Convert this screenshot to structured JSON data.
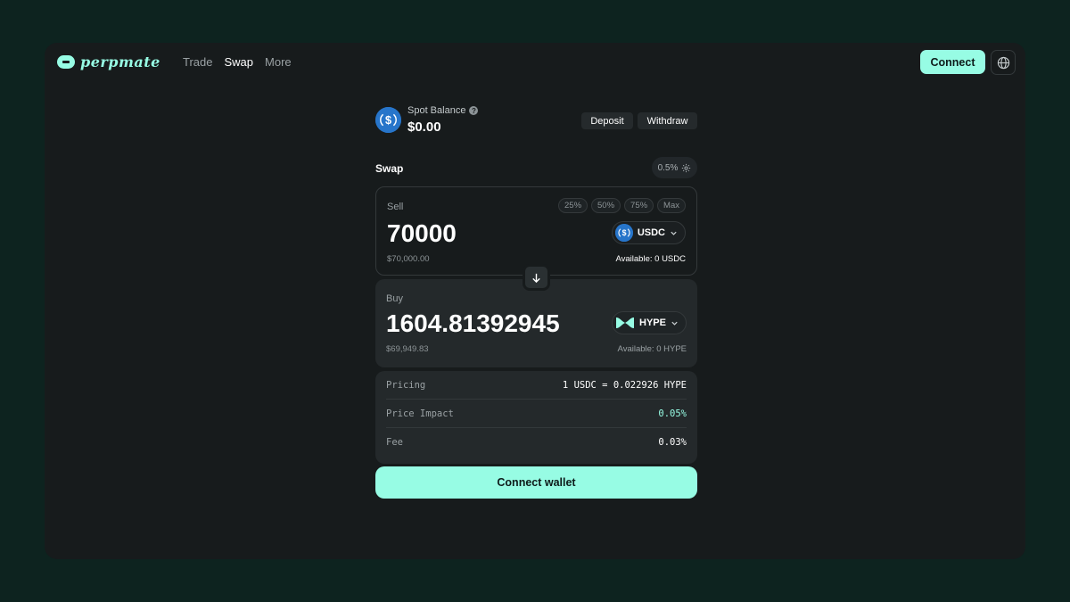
{
  "brand": {
    "name": "perpmate",
    "accent": "#97fce4"
  },
  "nav": {
    "links": [
      {
        "label": "Trade",
        "active": false
      },
      {
        "label": "Swap",
        "active": true
      },
      {
        "label": "More",
        "active": false
      }
    ],
    "connect_label": "Connect",
    "language_icon": "globe-icon"
  },
  "balance": {
    "label": "Spot Balance",
    "value": "$0.00",
    "deposit_label": "Deposit",
    "withdraw_label": "Withdraw"
  },
  "swap": {
    "title": "Swap",
    "slippage": "0.5%",
    "sell": {
      "label": "Sell",
      "percent_buttons": [
        "25%",
        "50%",
        "75%",
        "Max"
      ],
      "amount": "70000",
      "token": "USDC",
      "usd_value": "$70,000.00",
      "available": "Available: 0 USDC"
    },
    "buy": {
      "label": "Buy",
      "amount": "1604.81392945",
      "token": "HYPE",
      "usd_value": "$69,949.83",
      "available": "Available: 0 HYPE"
    },
    "details": [
      {
        "label": "Pricing",
        "value": "1 USDC = 0.022926 HYPE",
        "accent": false
      },
      {
        "label": "Price Impact",
        "value": "0.05%",
        "accent": true
      },
      {
        "label": "Fee",
        "value": "0.03%",
        "accent": false
      }
    ],
    "connect_wallet_label": "Connect wallet"
  }
}
